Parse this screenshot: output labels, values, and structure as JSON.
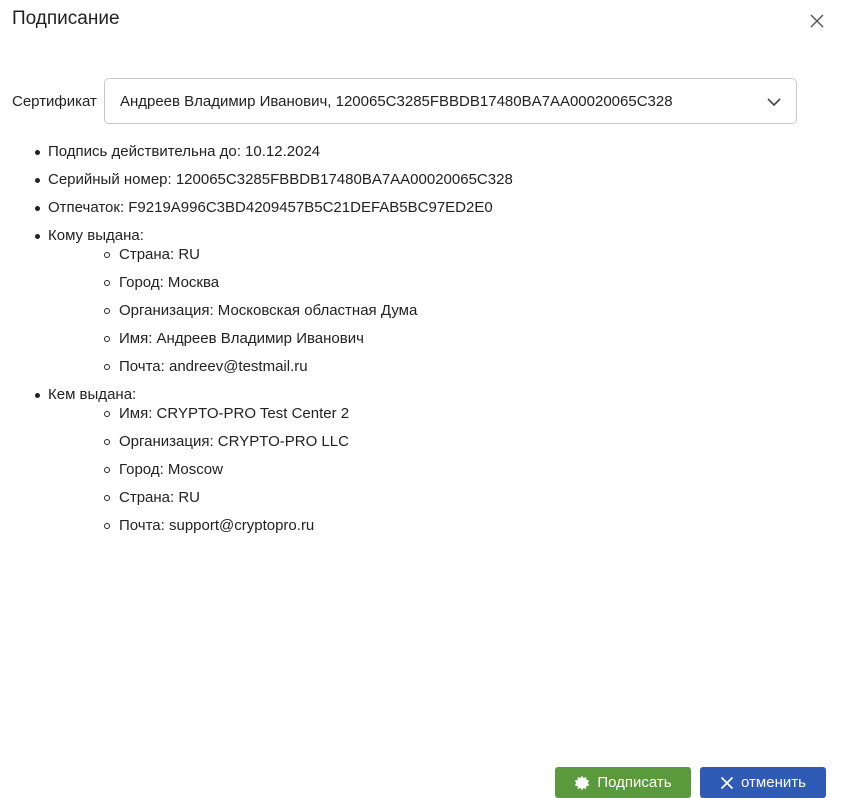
{
  "dialog": {
    "title": "Подписание"
  },
  "certificate": {
    "label": "Сертификат",
    "selected": "Андреев Владимир Иванович, 120065C3285FBBDB17480BA7AA00020065C328"
  },
  "info": {
    "valid_until": "Подпись действительна до: 10.12.2024",
    "serial": "Серийный номер: 120065C3285FBBDB17480BA7AA00020065C328",
    "thumbprint": "Отпечаток: F9219A996C3BD4209457B5C21DEFAB5BC97ED2E0",
    "issued_to": {
      "label": "Кому выдана:",
      "items": [
        "Страна: RU",
        "Город: Москва",
        "Организация: Московская областная Дума",
        "Имя: Андреев Владимир Иванович",
        "Почта: andreev@testmail.ru"
      ]
    },
    "issued_by": {
      "label": "Кем выдана:",
      "items": [
        "Имя: CRYPTO-PRO Test Center 2",
        "Организация: CRYPTO-PRO LLC",
        "Город: Moscow",
        "Страна: RU",
        "Почта: support@cryptopro.ru"
      ]
    }
  },
  "buttons": {
    "sign_label": "Подписать",
    "cancel_label": "отменить"
  },
  "colors": {
    "sign_button": "#5a9a3c",
    "cancel_button": "#2f5bb5"
  },
  "icons": {
    "close": "close-icon",
    "dropdown": "chevron-down-icon",
    "sign": "seal-icon",
    "cancel": "x-icon"
  }
}
